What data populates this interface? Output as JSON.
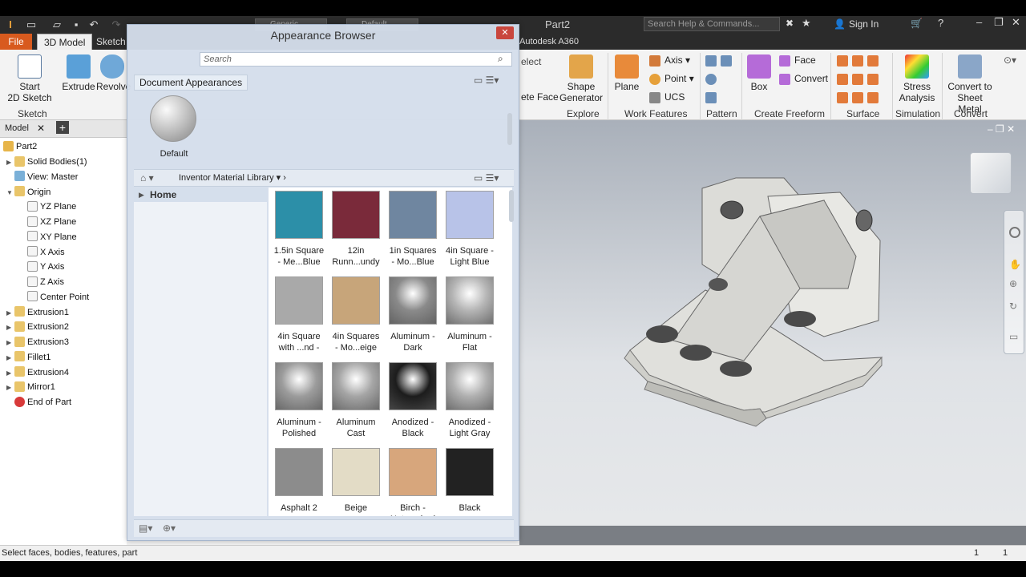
{
  "app": {
    "document_title": "Part2",
    "help_search_placeholder": "Search Help & Commands...",
    "sign_in": "Sign In",
    "qat_material": "Generic",
    "qat_appearance": "Default",
    "a360": "Autodesk A360"
  },
  "tabs": {
    "file": "File",
    "model3d": "3D Model",
    "sketch": "Sketch"
  },
  "ribbon": {
    "start_sketch": "Start\n2D Sketch",
    "extrude": "Extrude",
    "revolve": "Revolve",
    "sketch_panel": "Sketch",
    "shape_generator": "Shape\nGenerator",
    "explore_panel": "Explore",
    "plane": "Plane",
    "axis": "Axis",
    "point": "Point",
    "ucs": "UCS",
    "work_features_panel": "Work Features",
    "pattern_panel": "Pattern",
    "box": "Box",
    "face": "Face",
    "convert": "Convert",
    "create_freeform_panel": "Create Freeform",
    "surface_panel": "Surface",
    "stress_analysis": "Stress\nAnalysis",
    "simulation_panel": "Simulation",
    "convert_sheet_metal": "Convert to\nSheet Metal",
    "convert_panel": "Convert",
    "ghost_select": "elect",
    "ghost_delete_face": "ete Face"
  },
  "model_browser": {
    "tab_label": "Model",
    "root": "Part2",
    "items": [
      {
        "label": "Solid Bodies(1)",
        "indent": 1,
        "icon": "folder"
      },
      {
        "label": "View: Master",
        "indent": 1,
        "icon": "view"
      },
      {
        "label": "Origin",
        "indent": 1,
        "icon": "folder-open"
      },
      {
        "label": "YZ Plane",
        "indent": 2,
        "icon": "plane"
      },
      {
        "label": "XZ Plane",
        "indent": 2,
        "icon": "plane"
      },
      {
        "label": "XY Plane",
        "indent": 2,
        "icon": "plane"
      },
      {
        "label": "X Axis",
        "indent": 2,
        "icon": "axis"
      },
      {
        "label": "Y Axis",
        "indent": 2,
        "icon": "axis"
      },
      {
        "label": "Z Axis",
        "indent": 2,
        "icon": "axis"
      },
      {
        "label": "Center Point",
        "indent": 2,
        "icon": "point"
      },
      {
        "label": "Extrusion1",
        "indent": 1,
        "icon": "feature"
      },
      {
        "label": "Extrusion2",
        "indent": 1,
        "icon": "feature"
      },
      {
        "label": "Extrusion3",
        "indent": 1,
        "icon": "feature"
      },
      {
        "label": "Fillet1",
        "indent": 1,
        "icon": "feature"
      },
      {
        "label": "Extrusion4",
        "indent": 1,
        "icon": "feature"
      },
      {
        "label": "Mirror1",
        "indent": 1,
        "icon": "feature"
      },
      {
        "label": "End of Part",
        "indent": 1,
        "icon": "end"
      }
    ]
  },
  "dialog": {
    "title": "Appearance Browser",
    "close": "✕",
    "search_placeholder": "Search",
    "document_appearances": "Document Appearances",
    "default_swatch": "Default",
    "library_name": "Inventor Material Library",
    "home": "Home",
    "swatches": [
      {
        "name": "1.5in Square\n- Me...Blue",
        "color": "#2c8fa8"
      },
      {
        "name": "12in\nRunn...undy",
        "color": "#7a2a3a"
      },
      {
        "name": "1in Squares\n- Mo...Blue",
        "color": "#6f86a0"
      },
      {
        "name": "4in Square -\nLight Blue",
        "color": "#b8c3e8"
      },
      {
        "name": "4in Square\nwith ...nd -",
        "color": "#a9a9a9"
      },
      {
        "name": "4in Squares\n- Mo...eige",
        "color": "#c7a57a"
      },
      {
        "name": "Aluminum -\nDark",
        "color": "#8a8a8a"
      },
      {
        "name": "Aluminum -\nFlat",
        "color": "#b5b5b5"
      },
      {
        "name": "Aluminum -\nPolished",
        "color": "#9c9c9c"
      },
      {
        "name": "Aluminum\nCast",
        "color": "#a5a5a5"
      },
      {
        "name": "Anodized -\nBlack",
        "color": "#1c1c1c"
      },
      {
        "name": "Anodized -\nLight Gray",
        "color": "#b0b0b0"
      },
      {
        "name": "Asphalt 2",
        "color": "#8c8c8c"
      },
      {
        "name": "Beige",
        "color": "#e3dcc6"
      },
      {
        "name": "Birch -\nNatu...shed",
        "color": "#d7a67c"
      },
      {
        "name": "Black",
        "color": "#222222"
      }
    ]
  },
  "status": {
    "message": "Select faces, bodies, features, part",
    "count1": "1",
    "count2": "1"
  },
  "colors": {
    "file_tab": "#d85a1e",
    "close_button": "#c9463d"
  }
}
